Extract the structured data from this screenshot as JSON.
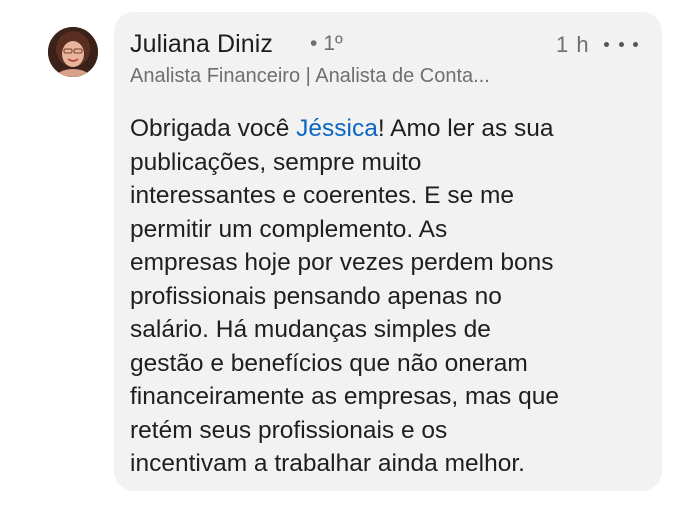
{
  "comment": {
    "author": {
      "name": "Juliana Diniz",
      "connection": "1º",
      "headline": "Analista Financeiro | Analista de Conta..."
    },
    "timestamp": "1 h",
    "more_icon": "more-horizontal-icon",
    "body": {
      "line1_before": "Obrigada você ",
      "mention": "Jéssica",
      "line1_after": "! Amo ler as sua",
      "lines": [
        "publicações, sempre muito",
        "interessantes e coerentes. E se me",
        "permitir um complemento. As",
        "empresas hoje por vezes perdem bons",
        "profissionais pensando apenas no",
        "salário. Há mudanças simples de",
        "gestão e benefícios que não oneram",
        "financeiramente as empresas, mas que",
        "retém seus profissionais e os",
        "incentivam a trabalhar ainda melhor."
      ]
    },
    "colors": {
      "bubble": "#f2f2f2",
      "mention": "#0a66c2",
      "secondary_text": "#6f6f6f"
    }
  }
}
